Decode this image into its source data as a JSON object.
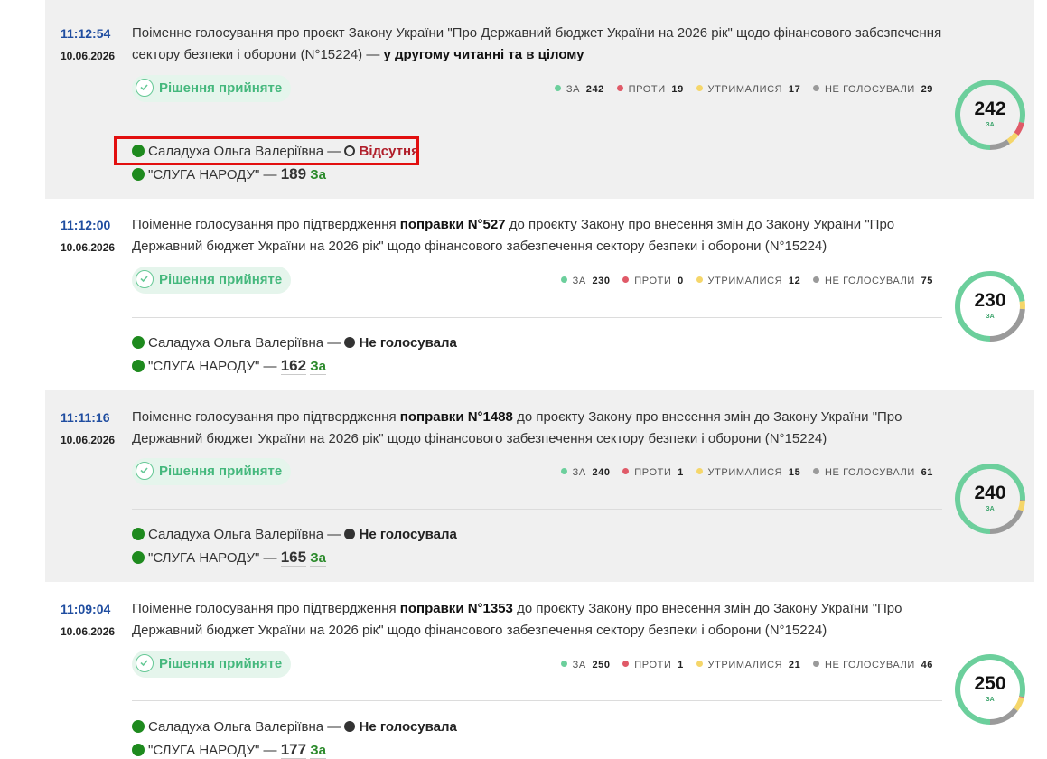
{
  "colors": {
    "za": "#6ccf9c",
    "proty": "#e05a68",
    "utrymalysia": "#f5d66a",
    "ne_holosuvaly": "#9a9a9a",
    "accent_time": "#1f4da0",
    "highlight": "#e20f0f"
  },
  "votes": [
    {
      "time": "11:12:54",
      "date": "10.06.2026",
      "title_pre": "Поіменне голосування про проєкт Закону України \"Про Державний бюджет України на 2026 рік\" щодо фінансового забезпечення сектору безпеки і оборони (N°15224) — ",
      "title_bold": "у другому читанні та в цілому",
      "title_post": "",
      "decision": "Рішення прийняте",
      "stats": {
        "za_label": "ЗА",
        "za": 242,
        "proty_label": "ПРОТИ",
        "proty": 19,
        "utrym_label": "УТРИМАЛИСЯ",
        "utrym": 17,
        "ne_label": "НЕ ГОЛОСУВАЛИ",
        "ne": 29
      },
      "ring_number": "242",
      "ring_label": "ЗА",
      "person_name": "Саладуха Ольга Валеріївна",
      "person_status": "Відсутня",
      "person_status_icon": "empty-circle-icon",
      "faction_name": "\"СЛУГА НАРОДУ\"",
      "faction_count": "189",
      "faction_vote": "За"
    },
    {
      "time": "11:12:00",
      "date": "10.06.2026",
      "title_pre": "Поіменне голосування про підтвердження ",
      "title_bold": "поправки N°527",
      "title_post": " до проєкту Закону про внесення змін до Закону України \"Про Державний бюджет України на 2026 рік\" щодо фінансового забезпечення сектору безпеки і оборони (N°15224)",
      "decision": "Рішення прийняте",
      "stats": {
        "za_label": "ЗА",
        "za": 230,
        "proty_label": "ПРОТИ",
        "proty": 0,
        "utrym_label": "УТРИМАЛИСЯ",
        "utrym": 12,
        "ne_label": "НЕ ГОЛОСУВАЛИ",
        "ne": 75
      },
      "ring_number": "230",
      "ring_label": "ЗА",
      "person_name": "Саладуха Ольга Валеріївна",
      "person_status": "Не голосувала",
      "person_status_icon": "filled-circle-icon",
      "faction_name": "\"СЛУГА НАРОДУ\"",
      "faction_count": "162",
      "faction_vote": "За"
    },
    {
      "time": "11:11:16",
      "date": "10.06.2026",
      "title_pre": "Поіменне голосування про підтвердження ",
      "title_bold": "поправки N°1488",
      "title_post": " до проєкту Закону про внесення змін до Закону України \"Про Державний бюджет України на 2026 рік\" щодо фінансового забезпечення сектору безпеки і оборони (N°15224)",
      "decision": "Рішення прийняте",
      "stats": {
        "za_label": "ЗА",
        "za": 240,
        "proty_label": "ПРОТИ",
        "proty": 1,
        "utrym_label": "УТРИМАЛИСЯ",
        "utrym": 15,
        "ne_label": "НЕ ГОЛОСУВАЛИ",
        "ne": 61
      },
      "ring_number": "240",
      "ring_label": "ЗА",
      "person_name": "Саладуха Ольга Валеріївна",
      "person_status": "Не голосувала",
      "person_status_icon": "filled-circle-icon",
      "faction_name": "\"СЛУГА НАРОДУ\"",
      "faction_count": "165",
      "faction_vote": "За"
    },
    {
      "time": "11:09:04",
      "date": "10.06.2026",
      "title_pre": "Поіменне голосування про підтвердження ",
      "title_bold": "поправки N°1353",
      "title_post": " до проєкту Закону про внесення змін до Закону України \"Про Державний бюджет України на 2026 рік\" щодо фінансового забезпечення сектору безпеки і оборони (N°15224)",
      "decision": "Рішення прийняте",
      "stats": {
        "za_label": "ЗА",
        "za": 250,
        "proty_label": "ПРОТИ",
        "proty": 1,
        "utrym_label": "УТРИМАЛИСЯ",
        "utrym": 21,
        "ne_label": "НЕ ГОЛОСУВАЛИ",
        "ne": 46
      },
      "ring_number": "250",
      "ring_label": "ЗА",
      "person_name": "Саладуха Ольга Валеріївна",
      "person_status": "Не голосувала",
      "person_status_icon": "filled-circle-icon",
      "faction_name": "\"СЛУГА НАРОДУ\"",
      "faction_count": "177",
      "faction_vote": "За"
    }
  ]
}
